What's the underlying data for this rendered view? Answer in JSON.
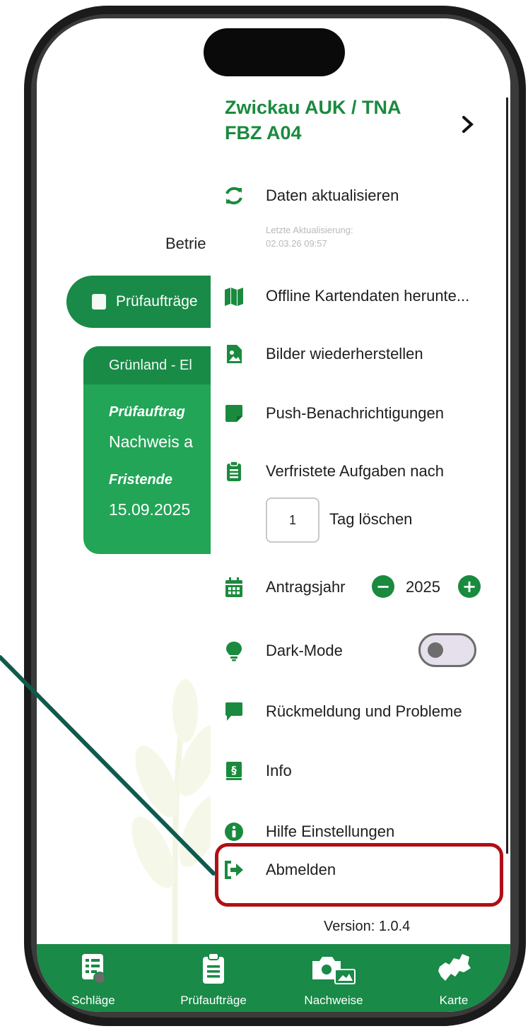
{
  "background": {
    "betrieb_text": "Betrie",
    "tab_label": "Prüfaufträge",
    "card": {
      "header": "Grünland - El",
      "label1": "Prüfauftrag",
      "value1": "Nachweis a",
      "label2": "Fristende",
      "value2": "15.09.2025"
    }
  },
  "drawer": {
    "account_line1": "Zwickau AUK / TNA",
    "account_line2": "FBZ A04",
    "items": {
      "refresh": "Daten aktualisieren",
      "refresh_note_line1": "Letzte Aktualisierung:",
      "refresh_note_line2": "02.03.26 09:57",
      "offline_maps": "Offline Kartendaten herunte...",
      "restore_images": "Bilder wiederherstellen",
      "push": "Push-Benachrichtigungen",
      "expired_tasks": "Verfristete Aufgaben nach",
      "days_value": "1",
      "days_label": "Tag löschen",
      "year_label": "Antragsjahr",
      "year_minus": "−",
      "year_value": "2025",
      "year_plus": "+",
      "dark_mode": "Dark-Mode",
      "dark_mode_on": false,
      "feedback": "Rückmeldung und Probleme",
      "info": "Info",
      "help": "Hilfe Einstellungen",
      "logout": "Abmelden"
    },
    "version": "Version: 1.0.4"
  },
  "bottom_nav": [
    {
      "label": "Schläge",
      "icon": "fields-list-icon"
    },
    {
      "label": "Prüfaufträge",
      "icon": "clipboard-icon"
    },
    {
      "label": "Nachweise",
      "icon": "camera-gallery-icon"
    },
    {
      "label": "Karte",
      "icon": "saxony-map-icon"
    }
  ],
  "colors": {
    "brand_green": "#198a47",
    "title_green": "#1a8a3e",
    "highlight_red": "#b00f15",
    "arrow_teal": "#0f5a4e"
  }
}
